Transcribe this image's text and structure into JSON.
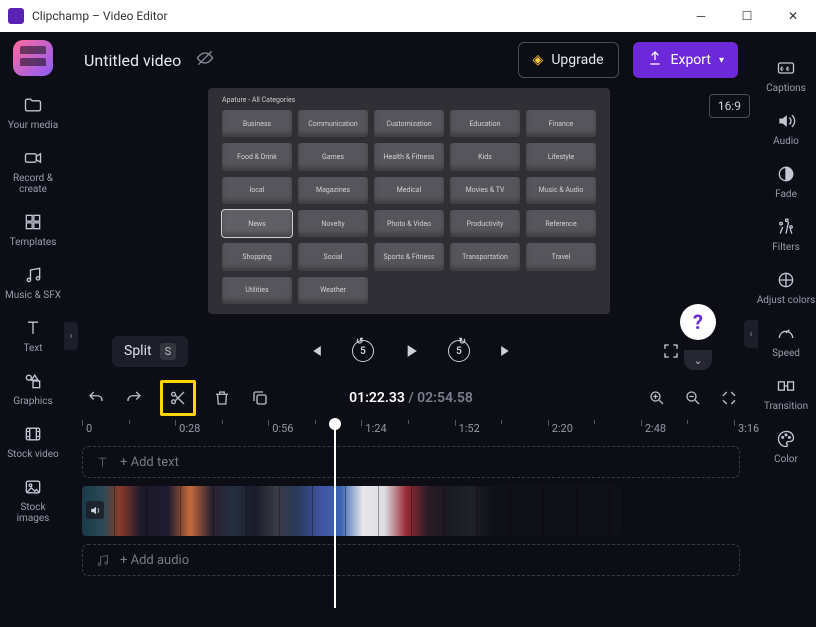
{
  "window": {
    "title": "Clipchamp – Video Editor"
  },
  "project": {
    "title": "Untitled video"
  },
  "header": {
    "upgrade_label": "Upgrade",
    "export_label": "Export"
  },
  "left_rail": [
    {
      "id": "your-media",
      "label": "Your media"
    },
    {
      "id": "record-create",
      "label": "Record & create"
    },
    {
      "id": "templates",
      "label": "Templates"
    },
    {
      "id": "music-sfx",
      "label": "Music & SFX"
    },
    {
      "id": "text",
      "label": "Text"
    },
    {
      "id": "graphics",
      "label": "Graphics"
    },
    {
      "id": "stock-video",
      "label": "Stock video"
    },
    {
      "id": "stock-images",
      "label": "Stock images"
    }
  ],
  "right_rail": [
    {
      "id": "captions",
      "label": "Captions"
    },
    {
      "id": "audio",
      "label": "Audio"
    },
    {
      "id": "fade",
      "label": "Fade"
    },
    {
      "id": "filters",
      "label": "Filters"
    },
    {
      "id": "adjust-colors",
      "label": "Adjust colors"
    },
    {
      "id": "speed",
      "label": "Speed"
    },
    {
      "id": "transition",
      "label": "Transition"
    },
    {
      "id": "color",
      "label": "Color"
    }
  ],
  "preview": {
    "title": "Apature - All Categories",
    "aspect_ratio": "16:9",
    "tiles": [
      "Business",
      "Communication",
      "Customization",
      "Education",
      "Finance",
      "Food & Drink",
      "Games",
      "Health & Fitness",
      "Kids",
      "Lifestyle",
      "local",
      "Magazines",
      "Medical",
      "Movies & TV",
      "Music & Audio",
      "News",
      "Novelty",
      "Photo & Video",
      "Productivity",
      "Reference",
      "Shopping",
      "Social",
      "Sports & Fitness",
      "Transportation",
      "Travel",
      "Utilities",
      "Weather"
    ],
    "selected_tile_index": 15
  },
  "tooltip": {
    "split_label": "Split",
    "split_key": "S"
  },
  "playback": {
    "current": "01:22.33",
    "total": "02:54.58",
    "skip_seconds": "5"
  },
  "ruler": {
    "labels": [
      "0",
      "0:28",
      "0:56",
      "1:24",
      "1:52",
      "2:20",
      "2:48",
      "3:16"
    ]
  },
  "tracks": {
    "add_text_label": "+ Add text",
    "add_audio_label": "+ Add audio"
  },
  "colors": {
    "accent": "#6d28d9",
    "highlight": "#ffd400"
  }
}
